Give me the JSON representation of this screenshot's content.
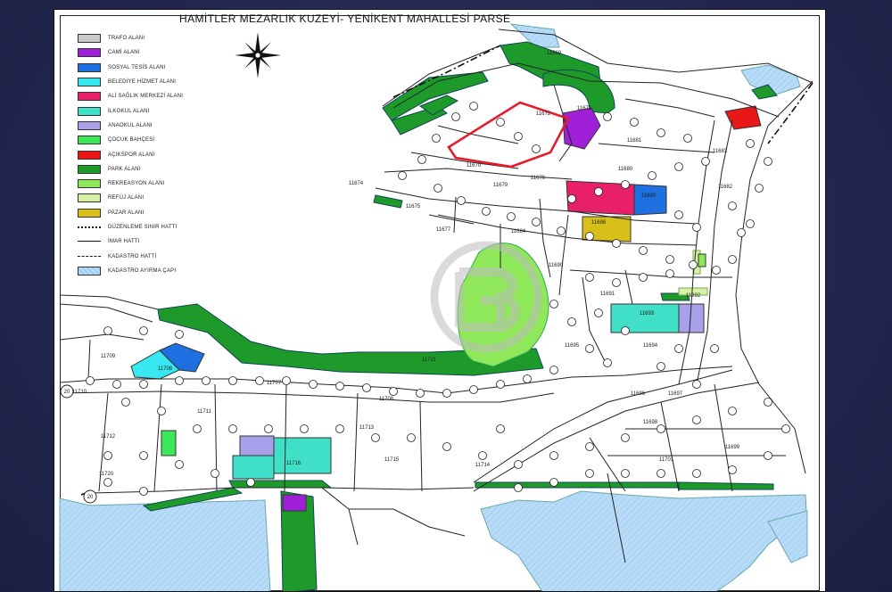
{
  "header": {
    "text": ""
  },
  "map": {
    "title": "HAMİTLER MEZARLIK KUZEYİ- YENİKENT MAHALLESİ PARSE",
    "colors": {
      "trafo": "#c8c8c8",
      "cami": "#a020d8",
      "sosyal": "#1e6fe0",
      "belediye": "#38e8f0",
      "saglik": "#e8206a",
      "ilkokul": "#40e0c8",
      "anaokul": "#a8a0e8",
      "cocuk": "#3ce858",
      "acikspor": "#e81818",
      "park": "#1e9a2a",
      "rekreasyon": "#8ee85a",
      "refuj": "#d8f0a8",
      "pazar": "#d8c018",
      "kadastro_ayirma": "#b8dcf8",
      "watermark": "#bdbdbd"
    },
    "legend": [
      {
        "label": "TRAFO ALANI",
        "swatch": "trafo",
        "kind": "box"
      },
      {
        "label": "CAMİ ALANI",
        "swatch": "cami",
        "kind": "box"
      },
      {
        "label": "SOSYAL TESİS ALANI",
        "swatch": "sosyal",
        "kind": "box"
      },
      {
        "label": "BELEDİYE HİZMET ALANI",
        "swatch": "belediye",
        "kind": "box"
      },
      {
        "label": "ALİ SAĞLIK MERKEZİ ALANI",
        "swatch": "saglik",
        "kind": "box"
      },
      {
        "label": "İLKOKUL ALANI",
        "swatch": "ilkokul",
        "kind": "box"
      },
      {
        "label": "ANAOKUL ALANI",
        "swatch": "anaokul",
        "kind": "box"
      },
      {
        "label": "ÇOCUK BAHÇESİ",
        "swatch": "cocuk",
        "kind": "box"
      },
      {
        "label": "AÇIKSPOR ALANI",
        "swatch": "acikspor",
        "kind": "box"
      },
      {
        "label": "PARK ALANI",
        "swatch": "park",
        "kind": "box"
      },
      {
        "label": "REKREASYON ALANI",
        "swatch": "rekreasyon",
        "kind": "box"
      },
      {
        "label": "REFÜJ ALANI",
        "swatch": "refuj",
        "kind": "box"
      },
      {
        "label": "PAZAR ALANI",
        "swatch": "pazar",
        "kind": "box"
      },
      {
        "label": "DÜZENLEME SINIR HATTI",
        "swatch": "",
        "kind": "dashdot"
      },
      {
        "label": "İMAR HATTI",
        "swatch": "",
        "kind": "line"
      },
      {
        "label": "KADASTRO HATTI",
        "swatch": "",
        "kind": "dash"
      },
      {
        "label": "KADASTRO AYIRMA ÇAPI",
        "swatch": "kadastro_ayirma",
        "kind": "hatch"
      }
    ],
    "parcels": [
      {
        "id": "11669",
        "near": "top"
      },
      {
        "id": "11672",
        "near": "highlight"
      },
      {
        "id": "11671",
        "near": "cami"
      },
      {
        "id": "11670",
        "near": "center-north"
      },
      {
        "id": "11679",
        "near": "center-north"
      },
      {
        "id": "11674",
        "near": "west"
      },
      {
        "id": "11675",
        "near": "west"
      },
      {
        "id": "11676",
        "near": "north"
      },
      {
        "id": "11677",
        "near": "north"
      },
      {
        "id": "11680",
        "near": "north-east"
      },
      {
        "id": "11681",
        "near": "north-east"
      },
      {
        "id": "11682",
        "near": "east"
      },
      {
        "id": "11683",
        "near": "east"
      },
      {
        "id": "11684",
        "near": "center"
      },
      {
        "id": "11685",
        "near": "sosyal"
      },
      {
        "id": "11686",
        "near": "pazar"
      },
      {
        "id": "11690",
        "near": "center"
      },
      {
        "id": "11691",
        "near": "center"
      },
      {
        "id": "11692",
        "near": "east"
      },
      {
        "id": "11693",
        "near": "ilkokul-east"
      },
      {
        "id": "11694",
        "near": "east"
      },
      {
        "id": "11695",
        "near": "center"
      },
      {
        "id": "11696",
        "near": "south-east"
      },
      {
        "id": "11697",
        "near": "south-east"
      },
      {
        "id": "11698",
        "near": "south-east"
      },
      {
        "id": "11699",
        "near": "south-east"
      },
      {
        "id": "11701",
        "near": "south-east"
      },
      {
        "id": "11706",
        "near": "south"
      },
      {
        "id": "11707",
        "near": "south"
      },
      {
        "id": "11708",
        "near": "west"
      },
      {
        "id": "11709",
        "near": "west"
      },
      {
        "id": "11710",
        "near": "west"
      },
      {
        "id": "11711",
        "near": "south-west"
      },
      {
        "id": "11712",
        "near": "south"
      },
      {
        "id": "11713",
        "near": "south"
      },
      {
        "id": "11714",
        "near": "south"
      },
      {
        "id": "11715",
        "near": "south"
      },
      {
        "id": "11716",
        "near": "south"
      },
      {
        "id": "11720",
        "near": "south-west"
      },
      {
        "id": "11721",
        "near": "park"
      }
    ],
    "markers": [
      "20",
      "20"
    ]
  }
}
